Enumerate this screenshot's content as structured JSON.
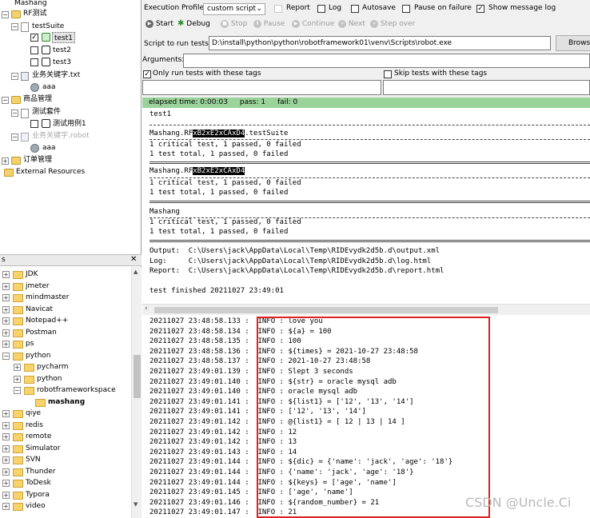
{
  "tree": [
    {
      "label": "Mashang",
      "kind": "none"
    },
    {
      "label": "RF测试",
      "kind": "folder"
    },
    {
      "label": "testSuite",
      "kind": "file"
    },
    {
      "label": "test1",
      "kind": "test",
      "checked": true,
      "selected": true
    },
    {
      "label": "test2",
      "kind": "test",
      "checked": false
    },
    {
      "label": "test3",
      "kind": "test",
      "checked": false
    },
    {
      "label": "业务关键字.txt",
      "kind": "resource"
    },
    {
      "label": "aaa",
      "kind": "keyword"
    },
    {
      "label": "商品管理",
      "kind": "folder"
    },
    {
      "label": "测试套件",
      "kind": "file"
    },
    {
      "label": "测试用例1",
      "kind": "test",
      "checked": false
    },
    {
      "label": "业务关键字.robot",
      "kind": "resource",
      "dim": true
    },
    {
      "label": "aaa",
      "kind": "keyword"
    },
    {
      "label": "订单管理",
      "kind": "folder"
    },
    {
      "label": "External Resources",
      "kind": "folder"
    }
  ],
  "filesystem": {
    "header_label": "s",
    "close_label": "✕",
    "items": [
      "JDK",
      "jmeter",
      "mindmaster",
      "Navicat",
      "Notepad++",
      "Postman",
      "ps",
      "python",
      "pycharm",
      "python",
      "robotframeworkspace",
      "mashang",
      "qiye",
      "redis",
      "remote",
      "Simulator",
      "SVN",
      "Thunder",
      "ToDesk",
      "Typora",
      "video"
    ]
  },
  "run": {
    "profile_label": "Execution Profile:",
    "profile_value": "custom script",
    "report_label": "Report",
    "log_label": "Log",
    "autosave_label": "Autosave",
    "pause_failure_label": "Pause on failure",
    "show_message_log_label": "Show message log",
    "show_message_log_checked": true,
    "start_label": "Start",
    "debug_label": "Debug",
    "stop_label": "Stop",
    "pause_label": "Pause",
    "continue_label": "Continue",
    "next_label": "Next",
    "step_over_label": "Step over",
    "script_label": "Script to run tests:",
    "script_value": "D:\\install\\python\\python\\robotframework01\\venv\\Scripts\\robot.exe",
    "browse_label": "Brows",
    "arguments_label": "Arguments:",
    "arguments_value": "",
    "only_tags_label": "Only run tests with these tags",
    "only_tags_checked": true,
    "skip_tags_label": "Skip tests with these tags",
    "skip_tags_checked": false
  },
  "status": {
    "elapsed": "elapsed time: 0:00:03",
    "pass": "pass: 1",
    "fail": "fail: 0"
  },
  "output": {
    "l1": "test1",
    "l2a": "Mashang.RF",
    "l2b": "xB2xE2xCAxD4",
    "l2c": ".testSuite",
    "l3": "1 critical test, 1 passed, 0 failed",
    "l4": "1 test total, 1 passed, 0 failed",
    "l5a": "Mashang.RF",
    "l5b": "xB2xE2xCAxD4",
    "l6": "1 critical test, 1 passed, 0 failed",
    "l7": "1 test total, 1 passed, 0 failed",
    "l8": "Mashang",
    "l9": "1 critical test, 1 passed, 0 failed",
    "l10": "1 test total, 1 passed, 0 failed",
    "l11": "Output:  C:\\Users\\jack\\AppData\\Local\\Temp\\RIDEvydk2d5b.d\\output.xml",
    "l12": "Log:     C:\\Users\\jack\\AppData\\Local\\Temp\\RIDEvydk2d5b.d\\log.html",
    "l13": "Report:  C:\\Users\\jack\\AppData\\Local\\Temp\\RIDEvydk2d5b.d\\report.html",
    "l14": "test finished 20211027 23:49:01"
  },
  "log": [
    "20211027 23:48:58.133 :  INFO : love you",
    "20211027 23:48:58.134 :  INFO : ${a} = 100",
    "20211027 23:48:58.135 :  INFO : 100",
    "20211027 23:48:58.136 :  INFO : ${times} = 2021-10-27 23:48:58",
    "20211027 23:48:58.137 :  INFO : 2021-10-27 23:48:58",
    "20211027 23:49:01.139 :  INFO : Slept 3 seconds",
    "20211027 23:49:01.140 :  INFO : ${str} = oracle mysql adb",
    "20211027 23:49:01.140 :  INFO : oracle mysql adb",
    "20211027 23:49:01.141 :  INFO : ${list1} = ['12', '13', '14']",
    "20211027 23:49:01.141 :  INFO : ['12', '13', '14']",
    "20211027 23:49:01.142 :  INFO : @{list1} = [ 12 | 13 | 14 ]",
    "20211027 23:49:01.142 :  INFO : 12",
    "20211027 23:49:01.142 :  INFO : 13",
    "20211027 23:49:01.143 :  INFO : 14",
    "20211027 23:49:01.144 :  INFO : ${dic} = {'name': 'jack', 'age': '18'}",
    "20211027 23:49:01.144 :  INFO : {'name': 'jack', 'age': '18'}",
    "20211027 23:49:01.144 :  INFO : ${keys} = ['age', 'name']",
    "20211027 23:49:01.145 :  INFO : ['age', 'name']",
    "20211027 23:49:01.146 :  INFO : ${random_number} = 21",
    "20211027 23:49:01.147 :  INFO : 21"
  ],
  "watermark": "CSDN @Uncle.Ci",
  "colors": {
    "status_bg": "#9ad49a",
    "highlight_box": "#e02020"
  }
}
